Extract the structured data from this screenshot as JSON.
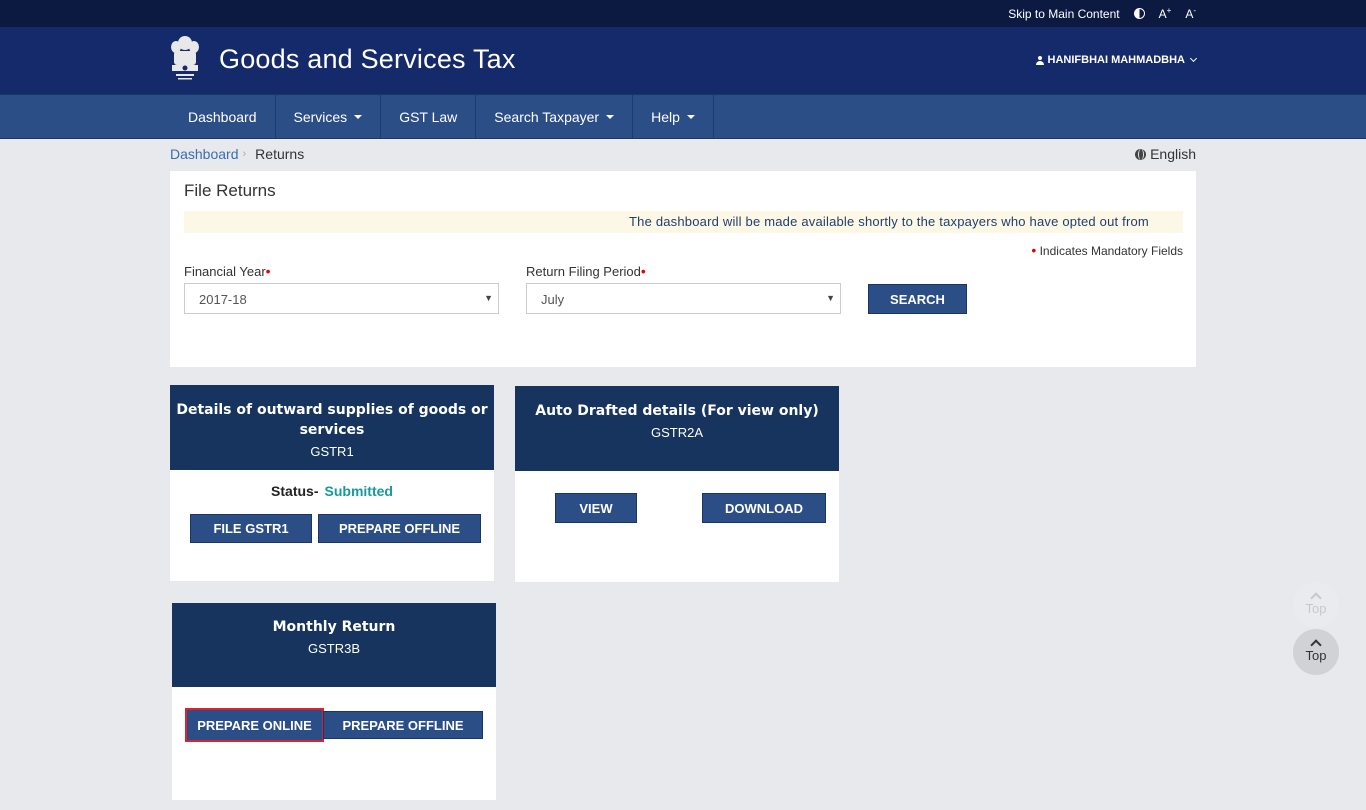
{
  "topbar": {
    "skip_link": "Skip to Main Content",
    "font_increase": "A",
    "font_increase_sup": "+",
    "font_decrease": "A",
    "font_decrease_sup": "-"
  },
  "header": {
    "title": "Goods and Services Tax",
    "user_name": "HANIFBHAI MAHMADBHA"
  },
  "nav": {
    "items": [
      {
        "label": "Dashboard"
      },
      {
        "label": "Services"
      },
      {
        "label": "GST Law"
      },
      {
        "label": "Search Taxpayer"
      },
      {
        "label": "Help"
      }
    ]
  },
  "breadcrumb": {
    "home": "Dashboard",
    "separator": "›",
    "current": "Returns"
  },
  "language": "English",
  "file_returns": {
    "title": "File Returns",
    "notice": "The dashboard will be made available shortly to the taxpayers who have opted out from",
    "mandatory_note": "Indicates Mandatory Fields",
    "required_marker": "•",
    "financial_year_label": "Financial Year",
    "financial_year_value": "2017-18",
    "period_label": "Return Filing Period",
    "period_value": "July",
    "search_label": "SEARCH"
  },
  "tiles": {
    "gstr1": {
      "title": "Details of outward supplies of goods or services",
      "code": "GSTR1",
      "status_label": "Status-",
      "status_value": "Submitted",
      "file_label": "FILE GSTR1",
      "offline_label": "PREPARE OFFLINE"
    },
    "gstr2a": {
      "title": "Auto Drafted details (For view only)",
      "code": "GSTR2A",
      "view_label": "VIEW",
      "download_label": "DOWNLOAD"
    },
    "gstr3b": {
      "title": "Monthly Return",
      "code": "GSTR3B",
      "online_label": "PREPARE ONLINE",
      "offline_label": "PREPARE OFFLINE"
    }
  },
  "scroll_top": {
    "label": "Top"
  },
  "colors": {
    "header_bg": "#152a6a",
    "nav_bg": "#2c4e86",
    "tile_head_bg": "#16345d",
    "status_submitted": "#179a9b",
    "highlight_outline": "#e0202a"
  }
}
